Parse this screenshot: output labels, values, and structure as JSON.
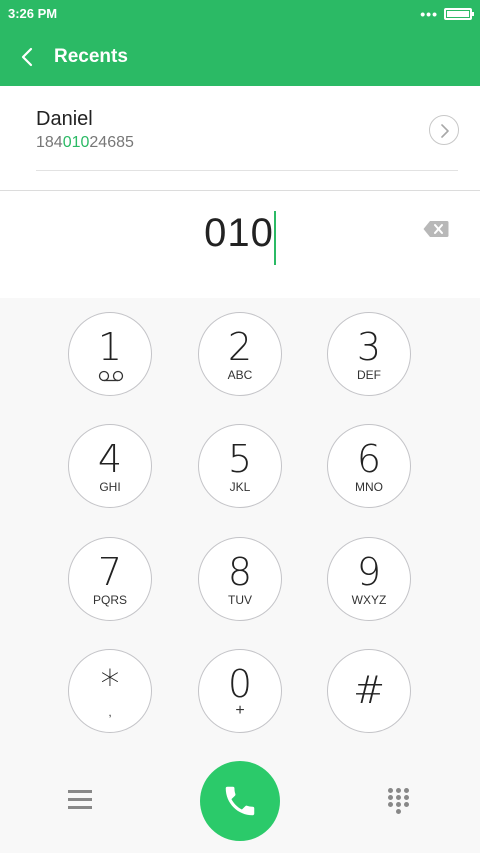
{
  "status_bar": {
    "time": "3:26 PM",
    "more": "•••"
  },
  "app_bar": {
    "title": "Recents"
  },
  "recent": {
    "name": "Daniel",
    "number_prefix": "184",
    "number_match": "010",
    "number_suffix": "24685"
  },
  "dialer": {
    "input": "010"
  },
  "keys": [
    {
      "digit": "1",
      "letters": ""
    },
    {
      "digit": "2",
      "letters": "ABC"
    },
    {
      "digit": "3",
      "letters": "DEF"
    },
    {
      "digit": "4",
      "letters": "GHI"
    },
    {
      "digit": "5",
      "letters": "JKL"
    },
    {
      "digit": "6",
      "letters": "MNO"
    },
    {
      "digit": "7",
      "letters": "PQRS"
    },
    {
      "digit": "8",
      "letters": "TUV"
    },
    {
      "digit": "9",
      "letters": "WXYZ"
    },
    {
      "digit": "*",
      "letters": ","
    },
    {
      "digit": "0",
      "letters": "+"
    },
    {
      "digit": "#",
      "letters": ""
    }
  ],
  "colors": {
    "accent": "#2bba65",
    "call": "#2bca6a"
  },
  "icons": {
    "back": "chevron-left-icon",
    "detail": "chevron-right-icon",
    "backspace": "backspace-icon",
    "voicemail": "voicemail-icon",
    "menu": "menu-icon",
    "call": "phone-icon",
    "keypad": "dialpad-icon"
  }
}
